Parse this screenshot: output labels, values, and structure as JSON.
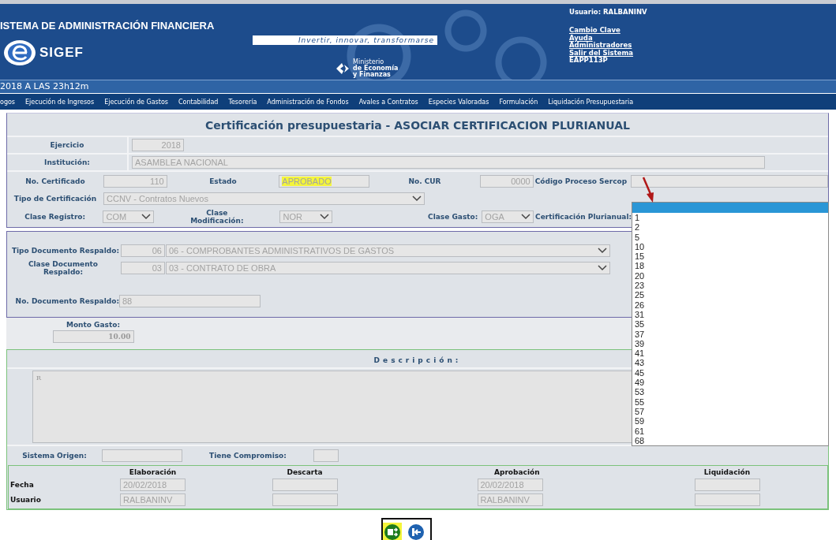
{
  "header": {
    "system_title": "ISTEMA DE ADMINISTRACIÓN FINANCIERA",
    "slogan": "Invertir, innovar, transformarse",
    "logo_text": "SIGEF",
    "ministry": [
      "Ministerio",
      "de Economía",
      "y Finanzas"
    ],
    "user": "Usuario: RALBANINV",
    "links": [
      "Cambio Clave",
      "Ayuda",
      "Administradores",
      "Salir del Sistema"
    ],
    "code": "EAPP113P"
  },
  "date_bar": "2018 A LAS 23h12m",
  "menu": [
    "ogos",
    "Ejecución de Ingresos",
    "Ejecución de Gastos",
    "Contabilidad",
    "Tesorería",
    "Administración de Fondos",
    "Avales a Contratos",
    "Especies Valoradas",
    "Formulación",
    "Liquidación Presupuestaria"
  ],
  "form": {
    "title": "Certificación presupuestaria - ASOCIAR CERTIFICACION PLURIANUAL",
    "ejercicio": {
      "label": "Ejercicio",
      "value": "2018"
    },
    "institucion": {
      "label": "Institución:",
      "value": "ASAMBLEA NACIONAL"
    },
    "no_certificado": {
      "label": "No. Certificado",
      "value": "110"
    },
    "estado": {
      "label": "Estado",
      "value": "APROBADO",
      "highlighted": true
    },
    "no_cur": {
      "label": "No. CUR",
      "value": "0000"
    },
    "codigo_sercop": {
      "label": "Código Proceso Sercop"
    },
    "tipo_certificacion": {
      "label": "Tipo de Certificación",
      "value": "CCNV - Contratos Nuevos"
    },
    "clase_registro": {
      "label": "Clase Registro:",
      "value": "COM"
    },
    "clase_modificacion": {
      "label": [
        "Clase",
        "Modificación:"
      ],
      "value": "NOR"
    },
    "clase_gasto": {
      "label": "Clase Gasto:",
      "value": "OGA"
    },
    "certificacion_plurianual": {
      "label": "Certificación Plurianual:",
      "blank_option_highlighted": true,
      "options": [
        "1",
        "2",
        "5",
        "10",
        "15",
        "18",
        "20",
        "23",
        "25",
        "26",
        "31",
        "35",
        "37",
        "39",
        "41",
        "43",
        "45",
        "49",
        "53",
        "55",
        "57",
        "59",
        "61",
        "68"
      ]
    },
    "tipo_documento": {
      "label": "Tipo Documento Respaldo:",
      "code": "06",
      "value": "06 - COMPROBANTES ADMINISTRATIVOS DE GASTOS"
    },
    "clase_documento": {
      "label": [
        "Clase Documento",
        "Respaldo:"
      ],
      "code": "03",
      "value": "03 - CONTRATO DE OBRA"
    },
    "no_documento": {
      "label": "No. Documento Respaldo:",
      "value": "88"
    },
    "monto_gasto": {
      "label": "Monto Gasto:",
      "value": "10.00"
    },
    "descripcion": {
      "label": "Descripción:",
      "value": "R"
    },
    "sistema_origen": {
      "label": "Sistema Origen:"
    },
    "tiene_compromiso": {
      "label": "Tiene Compromiso:"
    }
  },
  "signatures": {
    "columns": [
      "Elaboración",
      "Descarta",
      "Aprobación",
      "Liquidación"
    ],
    "rows": [
      {
        "label": "Fecha",
        "elaboracion": "20/02/2018",
        "aprobacion": "20/02/2018"
      },
      {
        "label": "Usuario",
        "elaboracion": "RALBANINV",
        "aprobacion": "RALBANINV"
      }
    ]
  },
  "actions": [
    {
      "kind": "process",
      "highlighted": true
    },
    {
      "kind": "exit",
      "highlighted": false
    }
  ],
  "annotation_arrow": true
}
